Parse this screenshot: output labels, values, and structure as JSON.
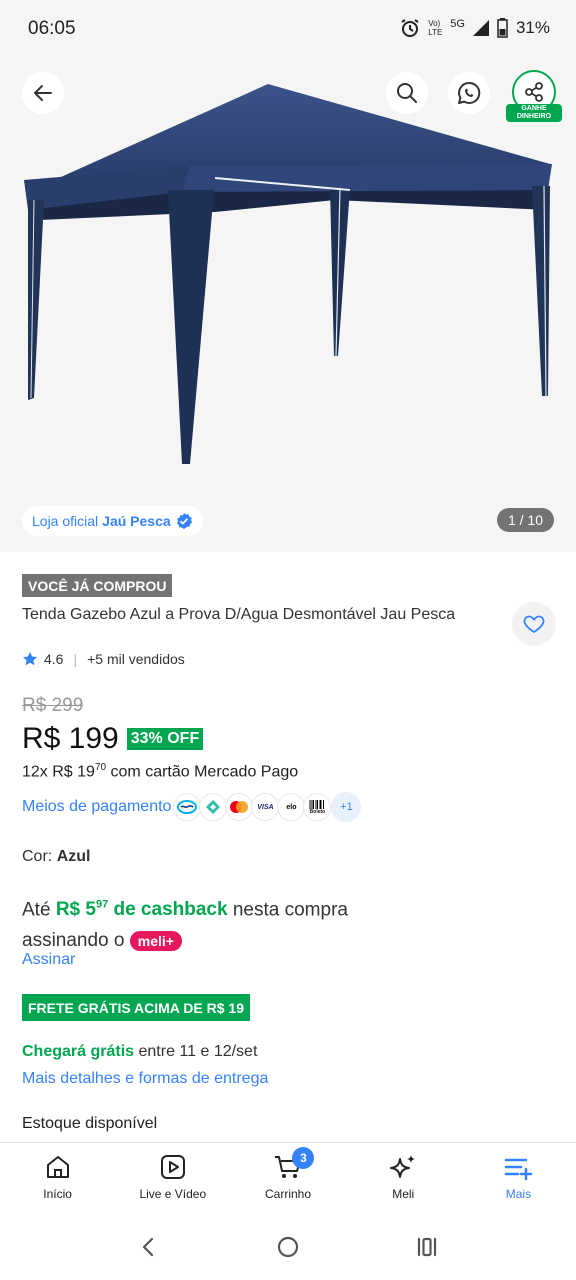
{
  "status_bar": {
    "time": "06:05",
    "network_top": "Vo)",
    "network_bottom": "LTE",
    "signal": "5G",
    "battery": "31%",
    "icons": [
      "alarm-icon",
      "signal-icon",
      "battery-icon"
    ]
  },
  "gallery": {
    "store_prefix": "Loja oficial",
    "store_name": "Jaú Pesca",
    "counter": "1 / 10",
    "share_badge": "GANHE DINHEIRO",
    "icons": [
      "arrow-left-icon",
      "search-icon",
      "whatsapp-icon",
      "share-icon",
      "verified-icon"
    ]
  },
  "product": {
    "bought_tag": "VOCÊ JÁ COMPROU",
    "title": "Tenda Gazebo Azul a Prova D/Agua Desmontável Jau Pesca",
    "rating": "4.6",
    "sold": "+5 mil vendidos",
    "old_price": "R$ 299",
    "price": "R$ 199",
    "discount": "33% OFF",
    "installments_prefix": "12x R$ 19",
    "installments_cents": "70",
    "installments_suffix": "com cartão Mercado Pago",
    "payment_link": "Meios de pagamento",
    "payment_more": "+1",
    "payment_methods": [
      "mercado-pago",
      "pix",
      "mastercard",
      "visa",
      "elo",
      "boleto"
    ],
    "payment_labels": {
      "visa": "VISA",
      "elo": "elo",
      "boleto": "Boleto"
    },
    "color_label": "Cor:",
    "color_value": "Azul"
  },
  "cashback": {
    "prefix": "Até",
    "amount": "R$ 5",
    "amount_cents": "97",
    "label": "de cashback",
    "suffix": "nesta compra",
    "line2": "assinando o",
    "badge": "meli+",
    "link": "Assinar"
  },
  "shipping": {
    "tag": "FRETE GRÁTIS ACIMA DE R$ 19",
    "arrival_green": "Chegará grátis",
    "arrival_rest": "entre 11 e 12/set",
    "details_link": "Mais detalhes e formas de entrega",
    "stock": "Estoque disponível"
  },
  "bottom_nav": {
    "items": [
      {
        "label": "Início",
        "icon": "home-icon"
      },
      {
        "label": "Live e Vídeo",
        "icon": "play-icon"
      },
      {
        "label": "Carrinho",
        "icon": "cart-icon"
      },
      {
        "label": "Meli",
        "icon": "sparkle-icon"
      },
      {
        "label": "Mais",
        "icon": "menu-plus-icon"
      }
    ],
    "cart_count": "3"
  },
  "colors": {
    "accent_blue": "#3483fa",
    "green": "#00a650",
    "meli_pink": "#e8175d",
    "tent_blue": "#2b3f6b"
  }
}
